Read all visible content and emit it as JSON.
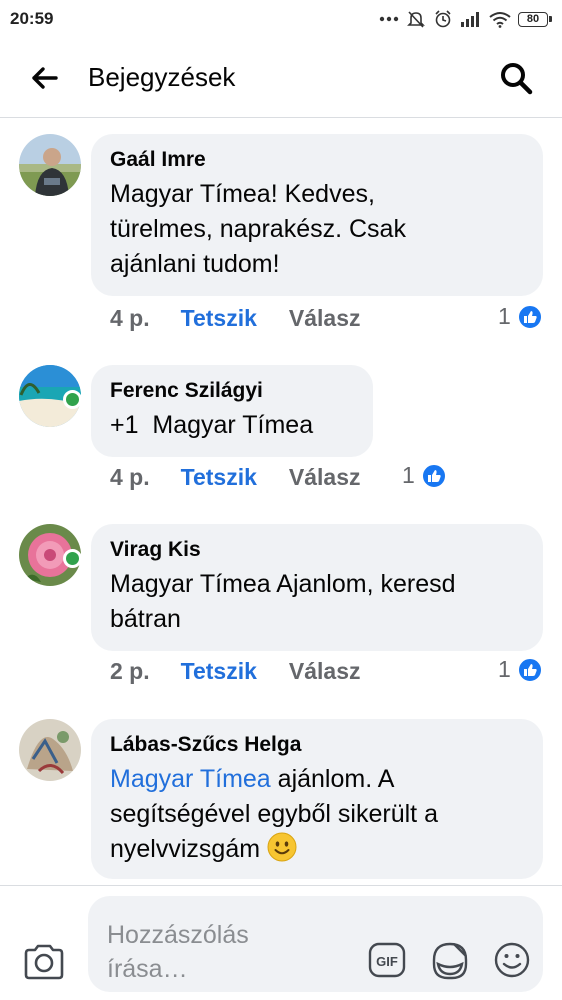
{
  "status_bar": {
    "time": "20:59",
    "battery": "80",
    "icons": [
      "more-dots-icon",
      "silent-bell-icon",
      "alarm-icon",
      "signal-icon",
      "wifi-icon",
      "battery-icon"
    ]
  },
  "header": {
    "title": "Bejegyzések",
    "back_icon": "arrow-left-icon",
    "search_icon": "search-icon"
  },
  "comments": [
    {
      "author": "Gaál Imre",
      "text": [
        "Magyar Tímea! Kedves,",
        "türelmes, naprakész. Csak",
        "ajánlani tudom!"
      ],
      "time": "4 p.",
      "like_label": "Tetszik",
      "reply_label": "Válasz",
      "reactions": "1",
      "online": false
    },
    {
      "author": "Ferenc Szilágyi",
      "text": [
        "+1  Magyar Tímea"
      ],
      "time": "4 p.",
      "like_label": "Tetszik",
      "reply_label": "Válasz",
      "reactions": "1",
      "online": true
    },
    {
      "author": "Virag Kis",
      "text": [
        "Magyar Tímea Ajanlom, keresd",
        "bátran"
      ],
      "time": "2 p.",
      "like_label": "Tetszik",
      "reply_label": "Válasz",
      "reactions": "1",
      "online": true
    },
    {
      "author": "Lábas-Szűcs Helga",
      "mention": "Magyar Tímea",
      "text": [
        " ajánlom. A",
        "segítségével egyből sikerült a",
        "nyelvvizsgám"
      ],
      "emoji": "smiling-face-icon",
      "online": false
    }
  ],
  "composer": {
    "placeholder": "Hozzászólás írása…",
    "gif_label": "GIF",
    "icons": [
      "camera-icon",
      "gif-icon",
      "sticker-icon",
      "emoji-icon"
    ]
  },
  "colors": {
    "link_blue": "#216fdb",
    "like_badge": "#1877f2",
    "bubble_bg": "#f0f2f5",
    "online_green": "#31a24c",
    "meta_gray": "#65676b"
  }
}
